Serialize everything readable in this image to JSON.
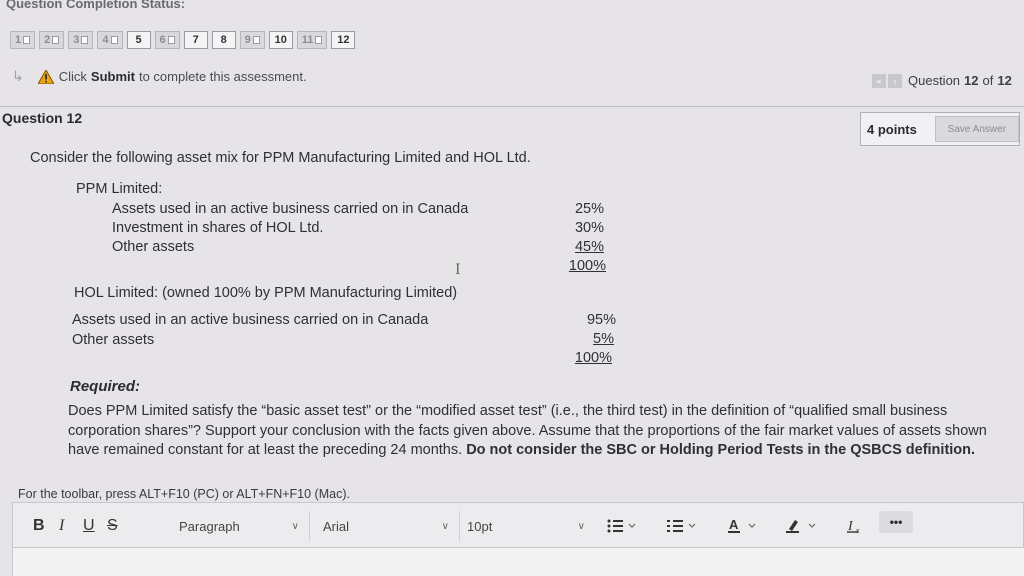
{
  "header": {
    "status_title": "Question Completion Status:"
  },
  "question_nav": [
    {
      "label": "1",
      "done": true
    },
    {
      "label": "2",
      "done": true
    },
    {
      "label": "3",
      "done": true
    },
    {
      "label": "4",
      "done": true
    },
    {
      "label": "5",
      "done": false
    },
    {
      "label": "6",
      "done": true
    },
    {
      "label": "7",
      "done": false
    },
    {
      "label": "8",
      "done": false
    },
    {
      "label": "9",
      "done": true
    },
    {
      "label": "10",
      "done": false
    },
    {
      "label": "11",
      "done": true
    },
    {
      "label": "12",
      "done": false
    }
  ],
  "submit_notice": {
    "prefix": "Click",
    "bold": "Submit",
    "suffix": "to complete this assessment."
  },
  "pager": {
    "first": "«",
    "prev": "‹",
    "label_prefix": "Question",
    "current": "12",
    "label_mid": "of",
    "total": "12"
  },
  "question": {
    "title": "Question 12",
    "points": "4 points",
    "save_label": "Save Answer",
    "intro": "Consider the following asset mix for PPM Manufacturing Limited and HOL Ltd.",
    "ppm": {
      "heading": "PPM Limited:",
      "rows": [
        {
          "label": "Assets used in an active business carried on in Canada",
          "value": "25%"
        },
        {
          "label": "Investment in shares of HOL Ltd.",
          "value": "30%"
        },
        {
          "label": "Other assets",
          "value": "45%"
        }
      ],
      "total": "100%"
    },
    "hol": {
      "heading": "HOL Limited: (owned 100% by PPM Manufacturing Limited)",
      "rows": [
        {
          "label": "Assets used in an active business carried on in Canada",
          "value": "95%"
        },
        {
          "label": "Other assets",
          "value": "5%"
        }
      ],
      "total": "100%"
    },
    "required_heading": "Required:",
    "required_text": "Does PPM Limited satisfy the “basic asset test” or the “modified asset test” (i.e., the third test) in the definition of “qualified small business corporation shares”? Support your conclusion with the facts given above. Assume that the proportions of the fair market values of assets shown have remained constant for at least the preceding 24 months.",
    "required_bold": "Do not consider the SBC or Holding Period Tests in the QSBCS definition."
  },
  "editor": {
    "toolbar_hint": "For the toolbar, press ALT+F10 (PC) or ALT+FN+F10 (Mac).",
    "bold": "B",
    "italic": "I",
    "underline": "U",
    "strike": "S",
    "block_format": "Paragraph",
    "font_family": "Arial",
    "font_size": "10pt",
    "more": "•••"
  }
}
